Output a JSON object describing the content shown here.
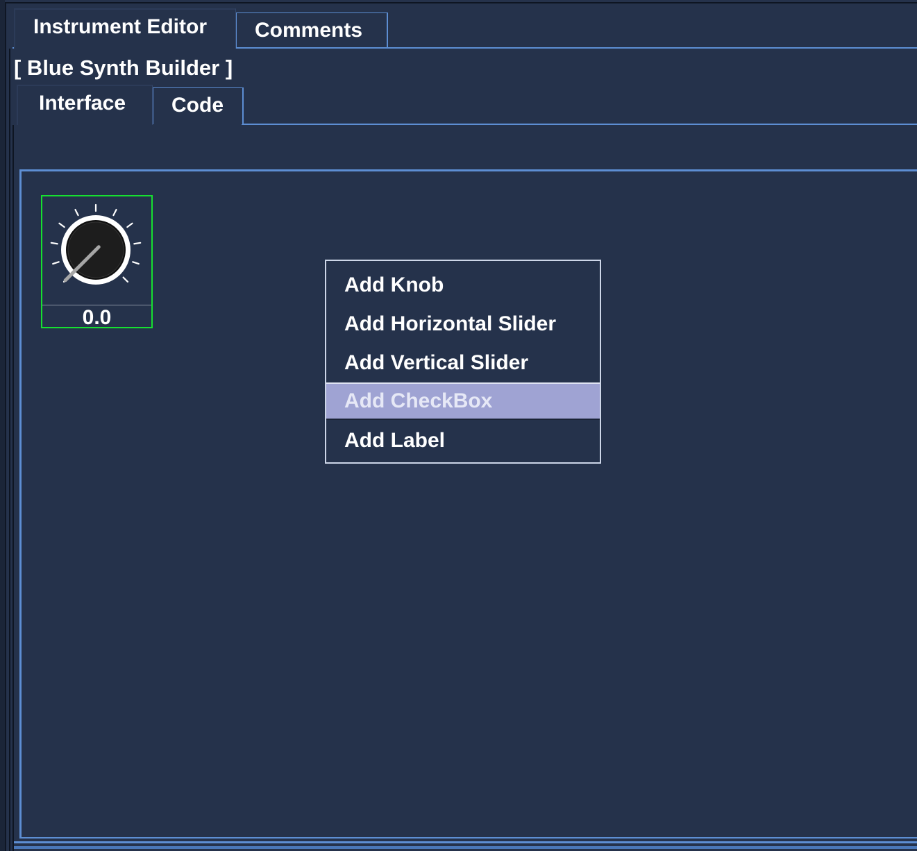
{
  "outer_tabs": [
    {
      "label": "Instrument Editor",
      "selected": true
    },
    {
      "label": "Comments",
      "selected": false
    }
  ],
  "builder_title": "[ Blue Synth Builder ]",
  "inner_tabs": [
    {
      "label": "Interface",
      "selected": true
    },
    {
      "label": "Code",
      "selected": false
    }
  ],
  "knob": {
    "value_text": "0.0",
    "value": 0.0,
    "border_color": "#16e030"
  },
  "context_menu": {
    "items": [
      {
        "label": "Add Knob",
        "highlighted": false
      },
      {
        "label": "Add Horizontal Slider",
        "highlighted": false
      },
      {
        "label": "Add Vertical Slider",
        "highlighted": false
      },
      {
        "label": "Add CheckBox",
        "highlighted": true
      },
      {
        "label": "Add Label",
        "highlighted": false
      }
    ]
  },
  "colors": {
    "background": "#25324b",
    "accent_blue": "#5d8ed3",
    "menu_highlight": "#9fa3d3",
    "text": "#ffffff"
  }
}
